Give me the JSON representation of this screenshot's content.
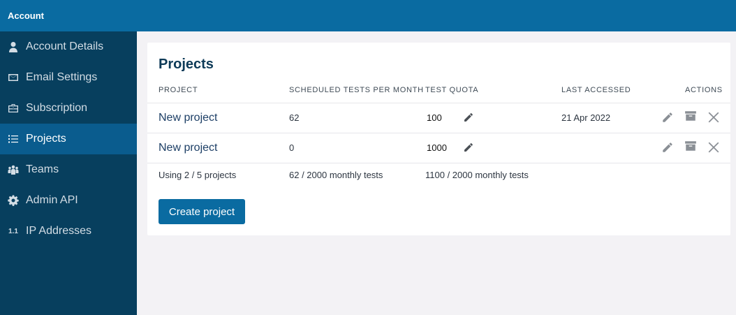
{
  "header": {
    "title": "Account"
  },
  "sidebar": {
    "items": [
      {
        "label": "Account Details",
        "icon": "user-icon"
      },
      {
        "label": "Email Settings",
        "icon": "envelope-icon"
      },
      {
        "label": "Subscription",
        "icon": "briefcase-icon"
      },
      {
        "label": "Projects",
        "icon": "list-icon",
        "active": true
      },
      {
        "label": "Teams",
        "icon": "team-icon"
      },
      {
        "label": "Admin API",
        "icon": "gear-icon"
      },
      {
        "label": "IP Addresses",
        "icon": "ip-version-icon",
        "icon_text": "1.1"
      }
    ]
  },
  "main": {
    "title": "Projects",
    "columns": [
      "PROJECT",
      "SCHEDULED TESTS PER MONTH",
      "TEST QUOTA",
      "LAST ACCESSED",
      "ACTIONS"
    ],
    "rows": [
      {
        "project": "New project",
        "scheduled": "62",
        "quota": "100",
        "last_accessed": "21 Apr 2022"
      },
      {
        "project": "New project",
        "scheduled": "0",
        "quota": "1000",
        "last_accessed": ""
      }
    ],
    "summary": {
      "projects": "Using 2 / 5 projects",
      "scheduled": "62 / 2000 monthly tests",
      "quota": "1100 / 2000 monthly tests"
    },
    "create_label": "Create project"
  },
  "colors": {
    "header": "#0a6ba1",
    "sidebar": "#073f5e",
    "sidebar_active": "#0a5c8e",
    "button": "#0a6ba1"
  }
}
